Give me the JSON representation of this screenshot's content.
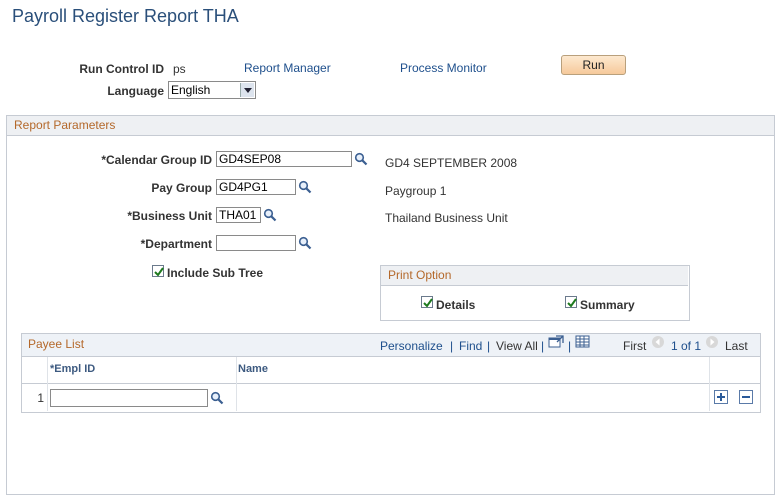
{
  "page": {
    "title": "Payroll Register Report THA"
  },
  "header": {
    "run_control_label": "Run Control ID",
    "run_control_value": "ps",
    "report_manager": "Report Manager",
    "process_monitor": "Process Monitor",
    "run_button": "Run",
    "language_label": "Language",
    "language_value": "English"
  },
  "report_parameters": {
    "section_title": "Report Parameters",
    "calendar_group": {
      "label": "*Calendar Group ID",
      "value": "GD4SEP08",
      "description": "GD4 SEPTEMBER 2008"
    },
    "pay_group": {
      "label": "Pay Group",
      "value": "GD4PG1",
      "description": "Paygroup 1"
    },
    "business_unit": {
      "label": "*Business Unit",
      "value": "THA01",
      "description": "Thailand Business Unit"
    },
    "department": {
      "label": "*Department",
      "value": ""
    },
    "include_sub_tree": {
      "label": "Include Sub Tree",
      "checked": true
    },
    "print_option": {
      "title": "Print Option",
      "details": {
        "label": "Details",
        "checked": true
      },
      "summary": {
        "label": "Summary",
        "checked": true
      }
    }
  },
  "payee_list": {
    "title": "Payee List",
    "toolbar": {
      "personalize": "Personalize",
      "find": "Find",
      "view_all": "View All",
      "sep": "|",
      "first": "First",
      "page_info": "1 of 1",
      "last": "Last"
    },
    "columns": [
      "*Empl ID",
      "Name"
    ],
    "rows": [
      {
        "num": "1",
        "empl_id": "",
        "name": ""
      }
    ]
  }
}
